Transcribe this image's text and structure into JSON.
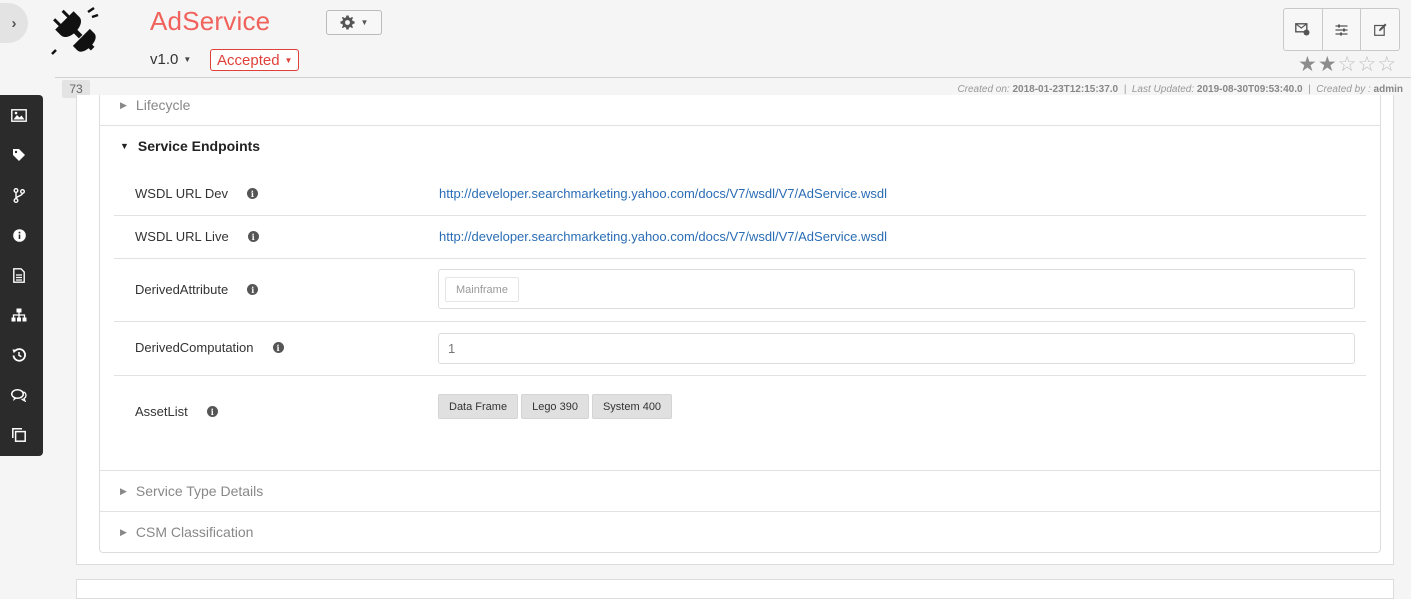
{
  "asset": {
    "title": "AdService",
    "version": "v1.0",
    "status": "Accepted",
    "count": "73",
    "rating": 2,
    "rating_max": 5
  },
  "meta": {
    "created_label": "Created on:",
    "created_value": "2018-01-23T12:15:37.0",
    "updated_label": "Last Updated:",
    "updated_value": "2019-08-30T09:53:40.0",
    "by_label": "Created by :",
    "by_value": "admin",
    "separator": "|"
  },
  "sections": {
    "lifecycle": "Lifecycle",
    "service_endpoints": "Service Endpoints",
    "service_type_details": "Service Type Details",
    "csm_classification": "CSM Classification"
  },
  "fields": {
    "wsdl_dev": {
      "label": "WSDL URL Dev",
      "value": "http://developer.searchmarketing.yahoo.com/docs/V7/wsdl/V7/AdService.wsdl"
    },
    "wsdl_live": {
      "label": "WSDL URL Live",
      "value": "http://developer.searchmarketing.yahoo.com/docs/V7/wsdl/V7/AdService.wsdl"
    },
    "derived_attribute": {
      "label": "DerivedAttribute",
      "value": "Mainframe"
    },
    "derived_computation": {
      "label": "DerivedComputation",
      "value": "1"
    },
    "asset_list": {
      "label": "AssetList",
      "items": [
        "Data Frame",
        "Lego 390",
        "System 400"
      ]
    }
  },
  "icons": {
    "sidebar": [
      "image-icon",
      "tag-icon",
      "branch-icon",
      "info-icon",
      "document-icon",
      "hierarchy-icon",
      "history-icon",
      "comments-icon",
      "copy-icon"
    ],
    "actions": [
      "subscribe-icon",
      "settings-sliders-icon",
      "edit-icon"
    ]
  },
  "colors": {
    "title": "#f0625b",
    "status": "#e0403a",
    "link": "#2a6db5",
    "sidebar_bg": "#2b2b2b"
  }
}
